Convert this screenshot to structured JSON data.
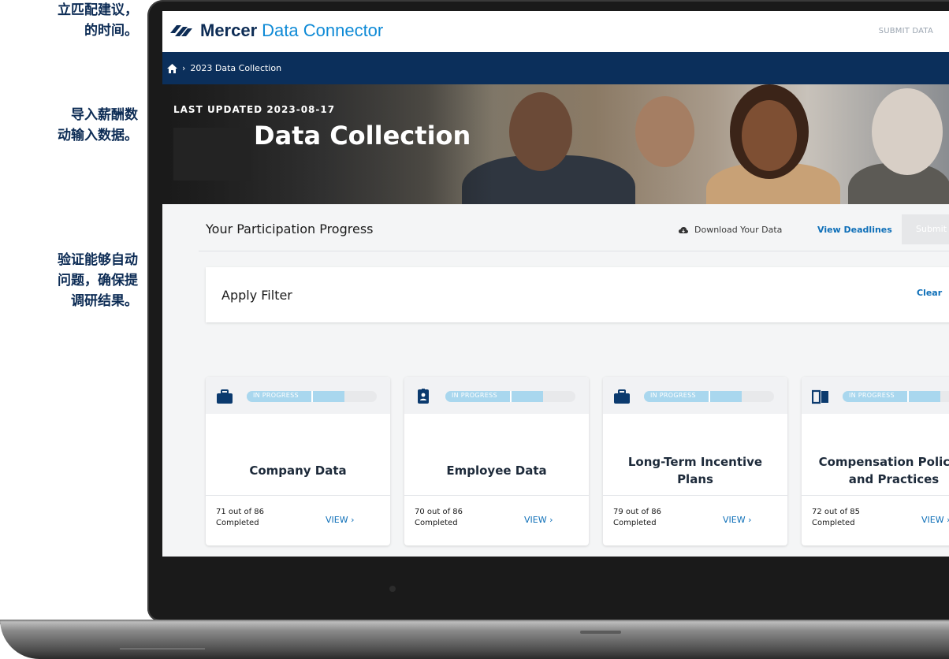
{
  "side_text": {
    "block1": [
      "立匹配建议，",
      "的时间。"
    ],
    "block2": [
      "导入薪酬数",
      "动输入数据。"
    ],
    "block3": [
      "验证能够自动",
      "问题，确保提",
      "调研结果。"
    ]
  },
  "header": {
    "brand_primary": "Mercer",
    "brand_secondary": "Data Connector",
    "submit_link": "SUBMIT DATA"
  },
  "breadcrumb": {
    "current": "2023 Data Collection"
  },
  "hero": {
    "updated": "LAST UPDATED 2023-08-17",
    "title": "Data Collection"
  },
  "progress": {
    "title": "Your Participation Progress",
    "download": "Download Your Data",
    "deadlines": "View Deadlines",
    "submit": "Submit"
  },
  "filter": {
    "title": "Apply Filter",
    "clear": "Clear"
  },
  "cards": [
    {
      "title": "Company Data",
      "status": "IN PROGRESS",
      "progress": 0.75,
      "count_line1": "71 out of 86",
      "count_line2": "Completed",
      "view": "VIEW  ›",
      "icon": "briefcase-icon"
    },
    {
      "title": "Employee Data",
      "status": "IN PROGRESS",
      "progress": 0.75,
      "count_line1": "70 out of 86",
      "count_line2": "Completed",
      "view": "VIEW  ›",
      "icon": "id-badge-icon"
    },
    {
      "title": "Long-Term Incentive Plans",
      "status": "IN PROGRESS",
      "progress": 0.75,
      "count_line1": "79 out of 86",
      "count_line2": "Completed",
      "view": "VIEW  ›",
      "icon": "briefcase-icon"
    },
    {
      "title": "Compensation Policies and Practices",
      "status": "IN PROGRESS",
      "progress": 0.75,
      "count_line1": "72 out of 85",
      "count_line2": "Completed",
      "view": "VIEW  ›",
      "icon": "book-icon"
    }
  ],
  "colors": {
    "navy": "#0b2f5b",
    "brand_blue": "#0e8ad6",
    "link_blue": "#0e6fb8",
    "progress_fill": "#a9d7ee"
  }
}
